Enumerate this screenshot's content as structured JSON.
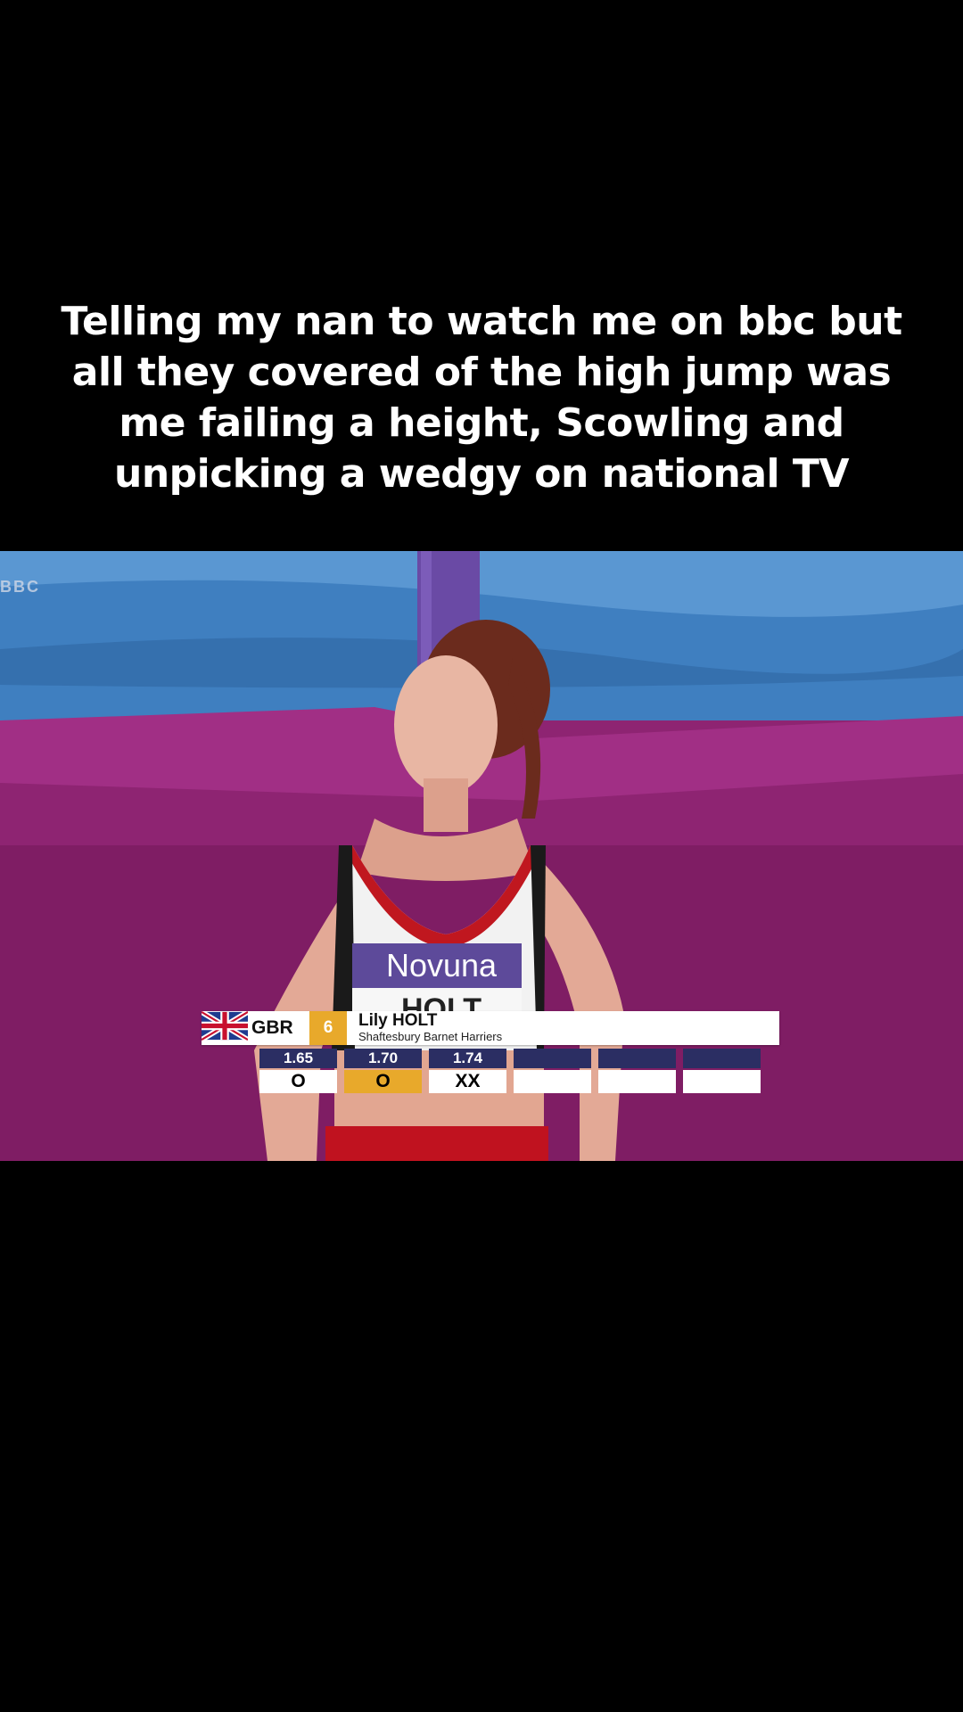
{
  "caption": "Telling my nan to watch me on bbc but all they covered of the high jump was me failing a height, Scowling and unpicking a wedgy on national TV",
  "video": {
    "channel_logo": "BBC",
    "bib_sponsor": "Novuna",
    "bib_name": "HOLT",
    "scoreboard": {
      "country": "GBR",
      "position": "6",
      "athlete_name": "Lily HOLT",
      "club": "Shaftesbury Barnet Harriers",
      "attempts": [
        {
          "height": "1.65",
          "result": "O",
          "highlight": false
        },
        {
          "height": "1.70",
          "result": "O",
          "highlight": true
        },
        {
          "height": "1.74",
          "result": "XX",
          "highlight": false
        },
        {
          "height": "",
          "result": "",
          "highlight": false
        },
        {
          "height": "",
          "result": "",
          "highlight": false
        },
        {
          "height": "",
          "result": "",
          "highlight": false
        }
      ],
      "colors": {
        "accent": "#e8a92b",
        "header": "#2b2e63"
      }
    }
  }
}
